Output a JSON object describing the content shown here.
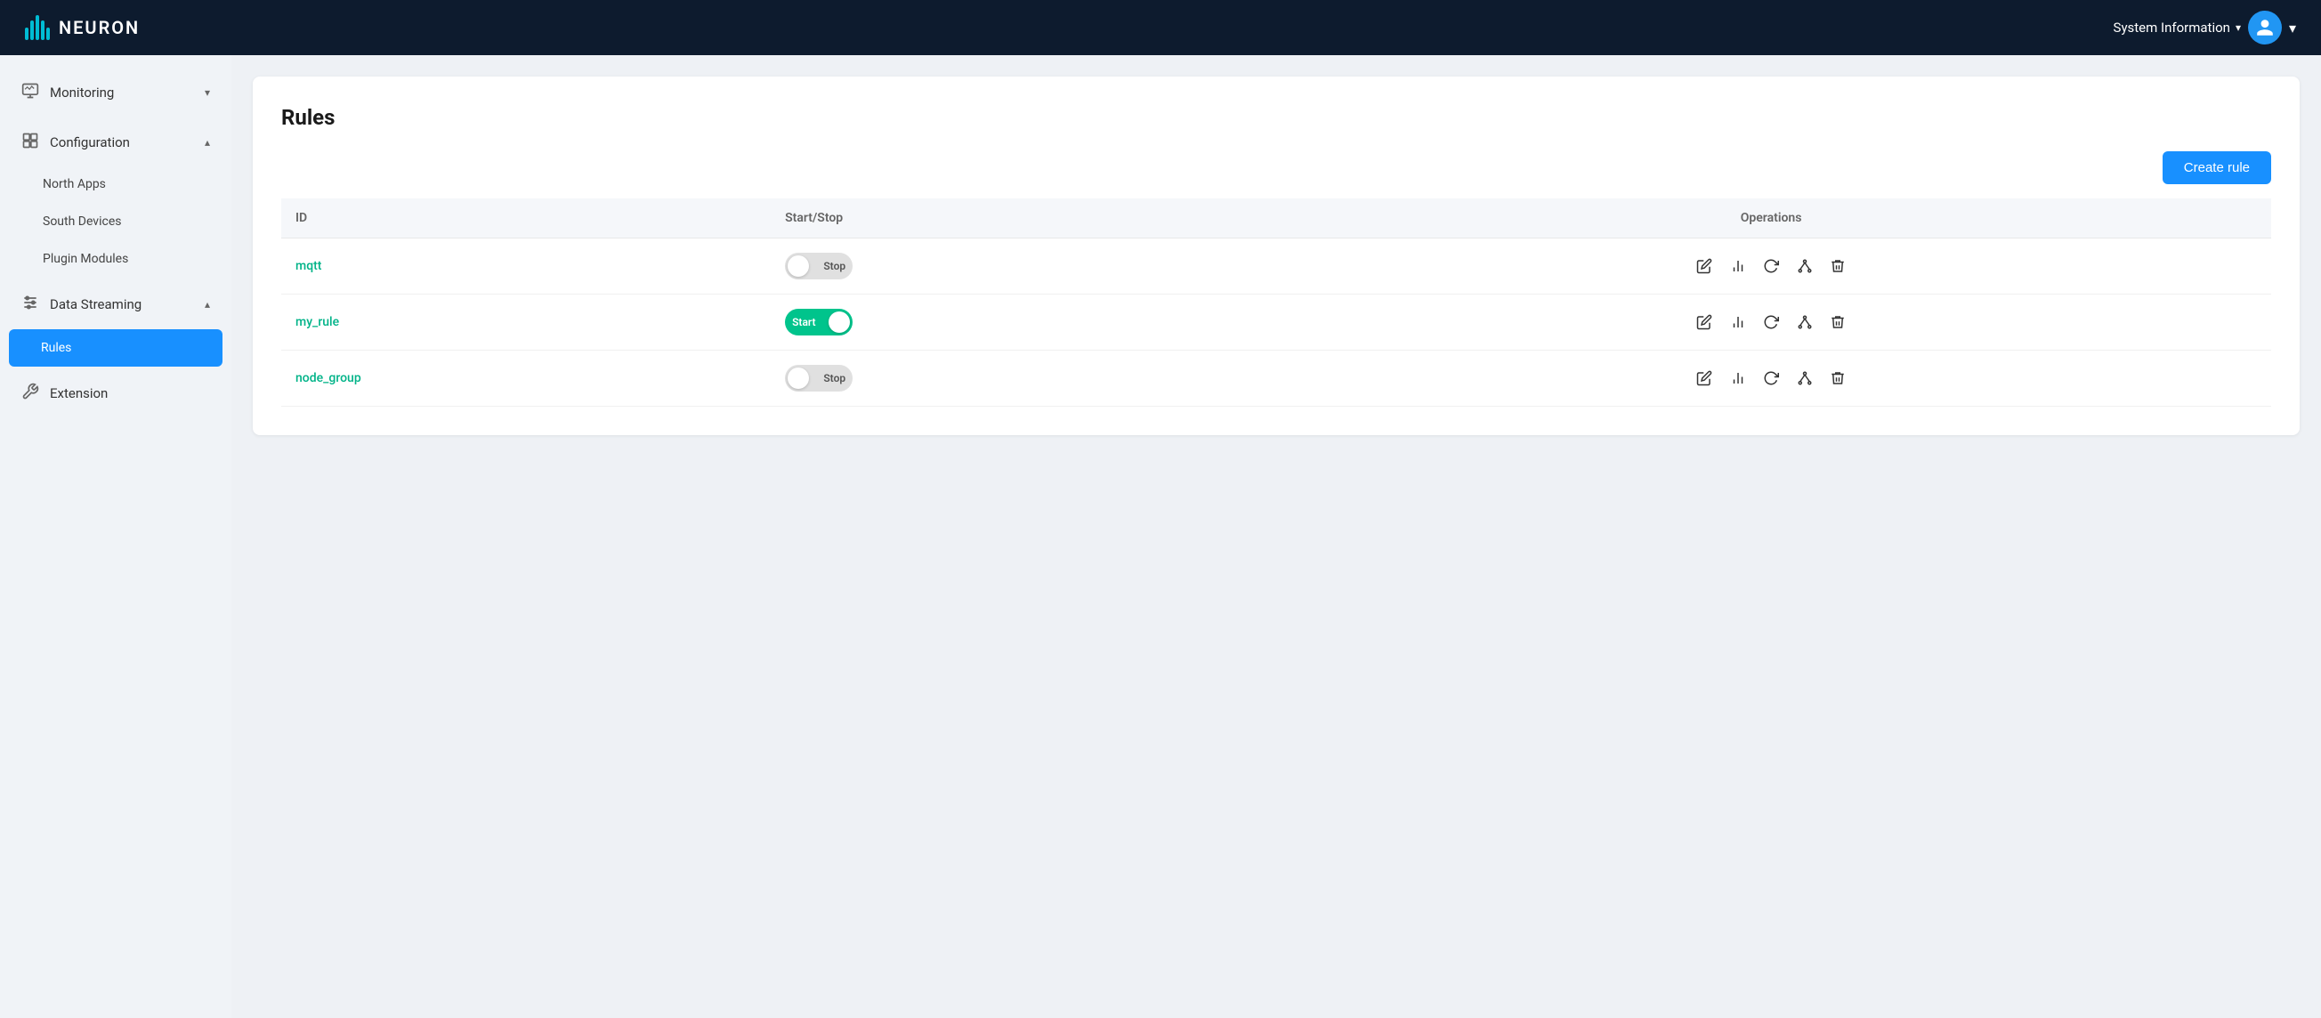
{
  "header": {
    "logo_text": "NEURON",
    "system_info_label": "System Information",
    "user_chevron": "▾"
  },
  "sidebar": {
    "groups": [
      {
        "id": "monitoring",
        "label": "Monitoring",
        "icon": "📈",
        "expanded": false,
        "items": []
      },
      {
        "id": "configuration",
        "label": "Configuration",
        "icon": "⚙",
        "expanded": true,
        "items": [
          {
            "id": "north-apps",
            "label": "North Apps"
          },
          {
            "id": "south-devices",
            "label": "South Devices"
          },
          {
            "id": "plugin-modules",
            "label": "Plugin Modules"
          }
        ]
      },
      {
        "id": "data-streaming",
        "label": "Data Streaming",
        "icon": "⚡",
        "expanded": true,
        "items": [
          {
            "id": "rules",
            "label": "Rules",
            "active": true
          }
        ]
      }
    ],
    "bottom_items": [
      {
        "id": "extension",
        "label": "Extension",
        "icon": "🔧"
      }
    ]
  },
  "content": {
    "page_title": "Rules",
    "create_rule_btn": "Create rule",
    "table": {
      "headers": [
        "ID",
        "Start/Stop",
        "Operations"
      ],
      "rows": [
        {
          "id": "mqtt",
          "status": "stopped",
          "status_label": "Stop"
        },
        {
          "id": "my_rule",
          "status": "running",
          "status_label": "Start"
        },
        {
          "id": "node_group",
          "status": "stopped",
          "status_label": "Stop"
        }
      ]
    }
  }
}
